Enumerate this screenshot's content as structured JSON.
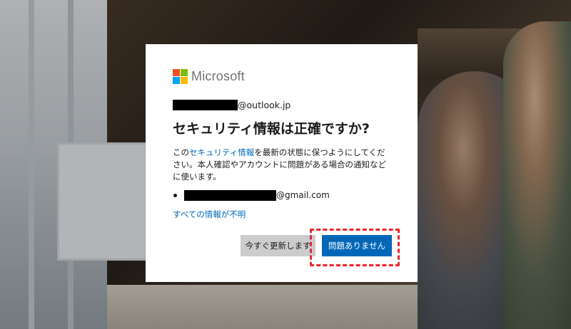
{
  "branding": {
    "name": "Microsoft"
  },
  "account": {
    "email_suffix": "@outlook.jp"
  },
  "dialog": {
    "title": "セキュリティ情報は正確ですか?",
    "desc_prefix": "この",
    "desc_link": "セキュリティ情報",
    "desc_suffix": "を最新の状態に保つようにしてください。本人確認やアカウントに問題がある場合の通知などに使います。",
    "security_items": [
      {
        "suffix": "@gmail.com"
      }
    ],
    "all_unknown_link": "すべての情報が不明"
  },
  "buttons": {
    "update_now": "今すぐ更新します",
    "no_problem": "問題ありません"
  },
  "colors": {
    "accent": "#0067b8",
    "highlight": "#e8262b"
  }
}
